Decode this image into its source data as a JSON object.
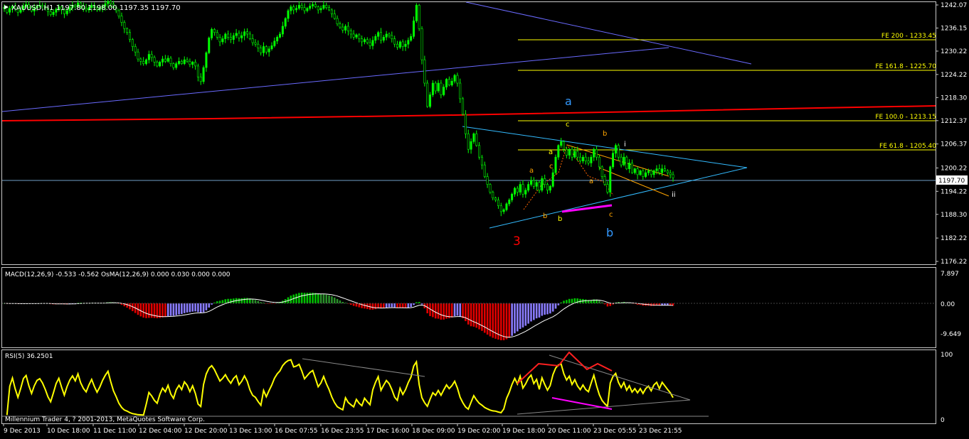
{
  "colors": {
    "bg": "#000000",
    "frame": "#c8c8c8",
    "candle": "#00ff00",
    "fib": "#ffff00",
    "red_line": "#ff0000",
    "blue_line": "#6a6aff",
    "cyan_line": "#33bbff",
    "orange": "#ffa500",
    "magenta": "#ff00ff",
    "macd_green": "#00c000",
    "macd_red": "#e00000",
    "macd_blue": "#8a7cff",
    "rsi": "#ffff00"
  },
  "header": {
    "symbol": "XAUUSD,H1",
    "ohlc": "1197.80 1198.00 1197.35 1197.70"
  },
  "fib_labels": [
    "FE 200 - 1233.45",
    "FE 161.8 - 1225.70",
    "FE 100.0 - 1213.15",
    "FE 61.8 - 1205.40"
  ],
  "wave_labels": {
    "big_a": "a",
    "big_b": "b",
    "big_3": "3",
    "small_c_top": "c",
    "small_b_top": "b",
    "small_i": "i",
    "small_ii": "ii",
    "small_a1": "a",
    "small_c1": "c",
    "small_b1": "b",
    "small_b2": "b",
    "small_a2": "a",
    "small_a3": "a",
    "small_c2": "c"
  },
  "macd": {
    "label": "MACD(12,26,9) -0.533 -0.562  OsMA(12,26,9) 0.000 0.030 0.000 0.000",
    "ticks": [
      "7.897",
      "0.00",
      "-9.649"
    ]
  },
  "rsi": {
    "label": "RSI(5) 36.2501",
    "ticks": [
      "100",
      "0"
    ]
  },
  "footer": "Millennium Trader 4, ? 2001-2013, MetaQuotes Software Corp.",
  "current_price": "1197.70",
  "chart_data": {
    "type": "candlestick",
    "symbol": "XAUUSD",
    "timeframe": "H1",
    "y_ticks": [
      "1242.07",
      "1236.15",
      "1230.22",
      "1224.22",
      "1218.30",
      "1212.37",
      "1206.37",
      "1200.22",
      "1194.22",
      "1188.30",
      "1182.22",
      "1176.22"
    ],
    "x_ticks": [
      "9 Dec 2013",
      "10 Dec 18:00",
      "11 Dec 11:00",
      "12 Dec 04:00",
      "12 Dec 20:00",
      "13 Dec 13:00",
      "16 Dec 07:55",
      "16 Dec 23:55",
      "17 Dec 16:00",
      "18 Dec 09:00",
      "19 Dec 02:00",
      "19 Dec 18:00",
      "20 Dec 11:00",
      "23 Dec 05:55",
      "23 Dec 21:55"
    ],
    "ylim": [
      1176.22,
      1242.07
    ],
    "close_series": [
      1241.5,
      1240.2,
      1241.2,
      1241.8,
      1241.1,
      1240.2,
      1240.8,
      1241.8,
      1242.2,
      1241.4,
      1240.5,
      1241.2,
      1241.8,
      1242.0,
      1241.7,
      1241.2,
      1240.4,
      1239.6,
      1240.2,
      1241.0,
      1241.6,
      1240.8,
      1239.8,
      1240.6,
      1241.4,
      1242.0,
      1241.6,
      1242.6,
      1241.8,
      1241.2,
      1240.8,
      1241.4,
      1242.0,
      1241.4,
      1240.8,
      1241.2,
      1241.8,
      1242.4,
      1243.0,
      1242.3,
      1241.4,
      1240.6,
      1239.2,
      1237.6,
      1236.0,
      1235.0,
      1233.2,
      1231.4,
      1230.0,
      1228.2,
      1227.6,
      1227.0,
      1228.0,
      1229.4,
      1228.6,
      1227.4,
      1226.4,
      1227.4,
      1228.2,
      1227.6,
      1228.4,
      1227.0,
      1226.0,
      1227.0,
      1227.6,
      1227.0,
      1228.0,
      1227.6,
      1226.8,
      1227.4,
      1226.4,
      1223.6,
      1222.4,
      1226.0,
      1229.8,
      1233.6,
      1235.8,
      1235.0,
      1233.8,
      1232.6,
      1233.4,
      1234.6,
      1233.8,
      1233.2,
      1234.2,
      1234.8,
      1233.6,
      1234.2,
      1235.2,
      1234.6,
      1233.4,
      1232.4,
      1232.0,
      1231.0,
      1229.8,
      1231.4,
      1230.0,
      1230.8,
      1231.6,
      1232.8,
      1233.8,
      1234.6,
      1236.6,
      1238.6,
      1240.6,
      1241.6,
      1240.8,
      1241.2,
      1242.0,
      1241.4,
      1240.6,
      1241.2,
      1241.8,
      1242.2,
      1241.6,
      1240.8,
      1241.2,
      1242.0,
      1241.4,
      1240.8,
      1239.8,
      1238.6,
      1237.2,
      1236.4,
      1235.6,
      1236.6,
      1235.4,
      1234.6,
      1233.8,
      1234.4,
      1233.4,
      1232.6,
      1233.2,
      1232.4,
      1231.6,
      1233.0,
      1234.0,
      1235.0,
      1233.0,
      1233.8,
      1234.6,
      1234.2,
      1233.4,
      1232.0,
      1231.2,
      1232.6,
      1231.4,
      1232.0,
      1233.0,
      1234.0,
      1238.0,
      1242.0,
      1236.0,
      1228.0,
      1222.0,
      1216.0,
      1219.0,
      1222.0,
      1220.0,
      1222.0,
      1219.0,
      1221.0,
      1223.0,
      1221.5,
      1222.5,
      1224.0,
      1222.0,
      1218.0,
      1214.0,
      1209.0,
      1205.0,
      1207.0,
      1209.0,
      1206.0,
      1203.0,
      1201.0,
      1198.0,
      1196.0,
      1194.0,
      1192.5,
      1192.0,
      1190.5,
      1189.0,
      1189.5,
      1191.0,
      1192.0,
      1193.5,
      1195.0,
      1194.0,
      1196.0,
      1193.5,
      1194.5,
      1196.0,
      1197.0,
      1195.5,
      1196.5,
      1194.5,
      1197.5,
      1196.0,
      1194.5,
      1195.5,
      1199.0,
      1203.0,
      1206.0,
      1207.0,
      1205.0,
      1203.5,
      1205.0,
      1203.0,
      1204.5,
      1203.0,
      1202.0,
      1203.0,
      1202.0,
      1201.5,
      1203.0,
      1205.0,
      1203.0,
      1200.5,
      1198.0,
      1196.0,
      1194.0,
      1200.5,
      1204.0,
      1206.0,
      1203.0,
      1201.0,
      1203.0,
      1200.0,
      1201.5,
      1199.0,
      1200.0,
      1198.5,
      1199.5,
      1198.0,
      1199.0,
      1199.5,
      1198.5,
      1199.5,
      1200.0,
      1199.0,
      1200.0,
      1199.5,
      1199.0,
      1198.5,
      1197.7
    ]
  }
}
